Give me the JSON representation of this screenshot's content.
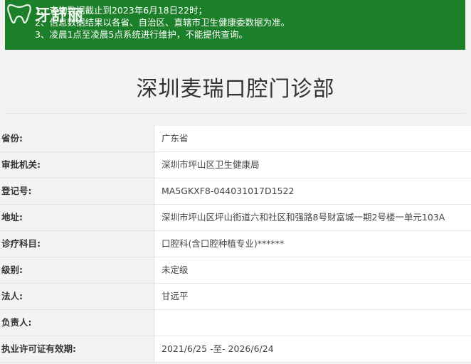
{
  "notice": {
    "lines": [
      "1、查询数据截止到2023年6月18日22时；",
      "2、信息数据结果以各省、自治区、直辖市卫生健康委数据为准。",
      "3、凌晨1点至凌晨5点系统进行维护，不能提供查询。"
    ]
  },
  "logo": {
    "text": "牙舒丽",
    "icon": "tooth-logo-icon"
  },
  "page_title": "深圳麦瑞口腔门诊部",
  "info": [
    {
      "label": "省份:",
      "value": "广东省"
    },
    {
      "label": "审批机关:",
      "value": "深圳市坪山区卫生健康局"
    },
    {
      "label": "登记号:",
      "value": "MA5GKXF8-044031017D1522"
    },
    {
      "label": "地址:",
      "value": "深圳市坪山区坪山街道六和社区和强路8号财富城一期2号楼一单元103A"
    },
    {
      "label": "诊疗科目:",
      "value": "口腔科(含口腔种植专业)******"
    },
    {
      "label": "级别:",
      "value": "未定级"
    },
    {
      "label": "法人:",
      "value": "甘远平"
    },
    {
      "label": "负责人:",
      "value": ""
    },
    {
      "label": "执业许可证有效期:",
      "value": "2021/6/25 -至- 2026/6/24"
    }
  ],
  "colors": {
    "notice_bg": "#1c7f29",
    "page_bg": "#f3f3f3",
    "value_bg": "#ffffff"
  }
}
